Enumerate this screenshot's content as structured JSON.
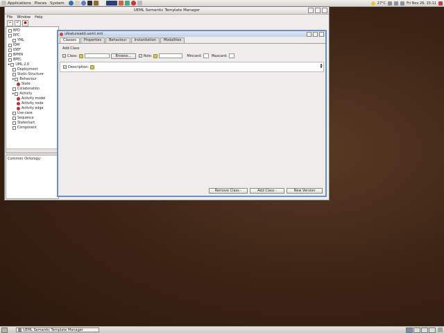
{
  "desktop": {
    "top_menus": [
      "Applications",
      "Places",
      "System"
    ],
    "clock": "Fri Nov 26, 15:11",
    "temperature": "27°C"
  },
  "window": {
    "title": "UEML Semantic Template Manager",
    "menus": [
      "File",
      "Window",
      "Help"
    ],
    "tree": [
      {
        "label": "BPD",
        "indent": 0,
        "icon": "file"
      },
      {
        "label": "EPC",
        "indent": 0,
        "icon": "file"
      },
      {
        "label": "YML",
        "indent": 1,
        "icon": "file"
      },
      {
        "label": "IDM",
        "indent": 0,
        "icon": "file"
      },
      {
        "label": "IDEF",
        "indent": 0,
        "icon": "file"
      },
      {
        "label": "BPMN",
        "indent": 0,
        "icon": "file"
      },
      {
        "label": "BPEL",
        "indent": 0,
        "icon": "file"
      },
      {
        "label": "UML 2.0",
        "indent": 0,
        "icon": "folder"
      },
      {
        "label": "Deployment",
        "indent": 1,
        "icon": "file"
      },
      {
        "label": "Static-Structure",
        "indent": 1,
        "icon": "file"
      },
      {
        "label": "Behaviour",
        "indent": 1,
        "icon": "folder"
      },
      {
        "label": "State",
        "indent": 2,
        "icon": "bean"
      },
      {
        "label": "Collaboration",
        "indent": 1,
        "icon": "file"
      },
      {
        "label": "Activity",
        "indent": 1,
        "icon": "folder"
      },
      {
        "label": "Activity model",
        "indent": 2,
        "icon": "bean"
      },
      {
        "label": "Activity node",
        "indent": 2,
        "icon": "bean"
      },
      {
        "label": "Activity edge",
        "indent": 2,
        "icon": "bean"
      },
      {
        "label": "Use-case",
        "indent": 1,
        "icon": "file"
      },
      {
        "label": "Sequence",
        "indent": 1,
        "icon": "file"
      },
      {
        "label": "Statechart",
        "indent": 1,
        "icon": "file"
      },
      {
        "label": "Component",
        "indent": 1,
        "icon": "file"
      }
    ],
    "common_ontology_label": "Common Ontology:"
  },
  "editor": {
    "title": "ufeatureadd.ueml.xml",
    "tabs": [
      "Classes",
      "Properties",
      "Behaviour",
      "Instantiation",
      "Modalities"
    ],
    "active_tab": "Classes",
    "section_label": "Add Class",
    "class_label": "Class:",
    "browse_label": "Browse...",
    "role_label": "Role:",
    "min_card_label": "Mincard:",
    "max_card_label": "Maxcard:",
    "description_label": "Description:",
    "class_checked": true,
    "role_checked": true,
    "description_checked": true,
    "remove_class_label": "Remove Class",
    "add_class_label": "Add Class",
    "new_version_label": "New Version"
  },
  "taskbar": {
    "task_label": "UEML Semantic Template Manager"
  },
  "colors": {
    "desktop": "#3f2616",
    "selection": "#6d8fbf"
  }
}
